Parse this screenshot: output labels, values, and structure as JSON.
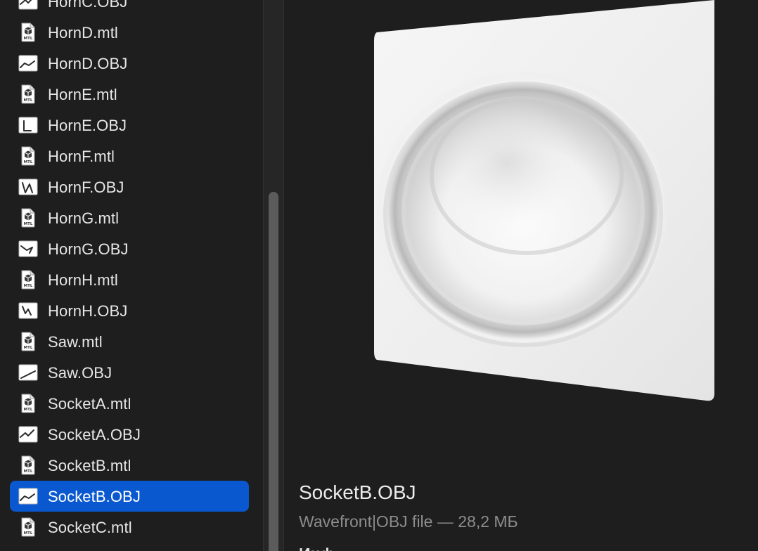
{
  "file_list": {
    "items": [
      {
        "name": "HornC.OBJ",
        "kind": "obj",
        "selected": false
      },
      {
        "name": "HornD.mtl",
        "kind": "mtl",
        "selected": false
      },
      {
        "name": "HornD.OBJ",
        "kind": "obj",
        "selected": false
      },
      {
        "name": "HornE.mtl",
        "kind": "mtl",
        "selected": false
      },
      {
        "name": "HornE.OBJ",
        "kind": "obj",
        "selected": false
      },
      {
        "name": "HornF.mtl",
        "kind": "mtl",
        "selected": false
      },
      {
        "name": "HornF.OBJ",
        "kind": "obj",
        "selected": false
      },
      {
        "name": "HornG.mtl",
        "kind": "mtl",
        "selected": false
      },
      {
        "name": "HornG.OBJ",
        "kind": "obj",
        "selected": false
      },
      {
        "name": "HornH.mtl",
        "kind": "mtl",
        "selected": false
      },
      {
        "name": "HornH.OBJ",
        "kind": "obj",
        "selected": false
      },
      {
        "name": "Saw.mtl",
        "kind": "mtl",
        "selected": false
      },
      {
        "name": "Saw.OBJ",
        "kind": "obj",
        "selected": false
      },
      {
        "name": "SocketA.mtl",
        "kind": "mtl",
        "selected": false
      },
      {
        "name": "SocketA.OBJ",
        "kind": "obj",
        "selected": false
      },
      {
        "name": "SocketB.mtl",
        "kind": "mtl",
        "selected": false
      },
      {
        "name": "SocketB.OBJ",
        "kind": "obj",
        "selected": true
      },
      {
        "name": "SocketC.mtl",
        "kind": "mtl",
        "selected": false
      }
    ],
    "mtl_icon_label": "MTL"
  },
  "preview": {
    "title": "SocketB.OBJ",
    "subtitle": "Wavefront|OBJ file — 28,2 МБ",
    "section_heading": "Инф"
  },
  "colors": {
    "background": "#1e1e1e",
    "selection": "#0a58d0",
    "text_primary": "#e6e6e6",
    "text_secondary": "#8c8c8c"
  },
  "icons": {
    "mtl": "mtl-document-icon",
    "obj": "obj-model-thumbnail-icon"
  }
}
